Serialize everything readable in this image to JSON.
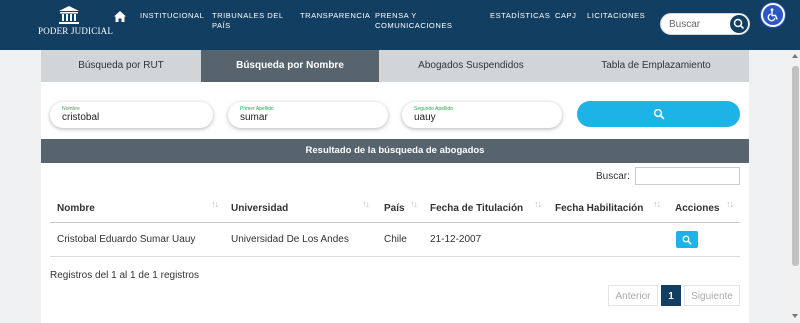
{
  "header": {
    "logo_text": "PODER JUDICIAL",
    "nav": [
      {
        "label": "INSTITUCIONAL"
      },
      {
        "label": "TRIBUNALES DEL",
        "label2": "PAÍS"
      },
      {
        "label": "TRANSPARENCIA"
      },
      {
        "label": "PRENSA Y",
        "label2": "COMUNICACIONES"
      },
      {
        "label": "ESTADÍSTICAS"
      },
      {
        "label": "CAPJ"
      },
      {
        "label": "LICITACIONES"
      }
    ],
    "search_placeholder": "Buscar"
  },
  "tabs": [
    {
      "label": "Búsqueda por RUT"
    },
    {
      "label": "Búsqueda por Nombre",
      "active": true
    },
    {
      "label": "Abogados Suspendidos"
    },
    {
      "label": "Tabla de Emplazamiento"
    }
  ],
  "form": {
    "nombre": {
      "label": "Nombre",
      "value": "cristobal"
    },
    "primer_apellido": {
      "label": "Primer Apellido",
      "value": "sumar"
    },
    "segundo_apellido": {
      "label": "Segundo Apellido",
      "value": "uauy"
    }
  },
  "results": {
    "title": "Resultado de la búsqueda de abogados",
    "search_label": "Buscar:",
    "columns": [
      "Nombre",
      "Universidad",
      "País",
      "Fecha de Titulación",
      "Fecha Habilitación",
      "Acciones"
    ],
    "rows": [
      [
        "Cristobal Eduardo Sumar Uauy",
        "Universidad De Los Andes",
        "Chile",
        "21-12-2007",
        ""
      ]
    ],
    "info": "Registros del 1 al 1 de 1 registros",
    "pagination": {
      "prev": "Anterior",
      "current": "1",
      "next": "Siguiente"
    }
  },
  "colors": {
    "header_bg": "#123e62",
    "tab_active": "#57646d",
    "accent": "#1eb3e6",
    "label_green": "#2fa84f"
  }
}
